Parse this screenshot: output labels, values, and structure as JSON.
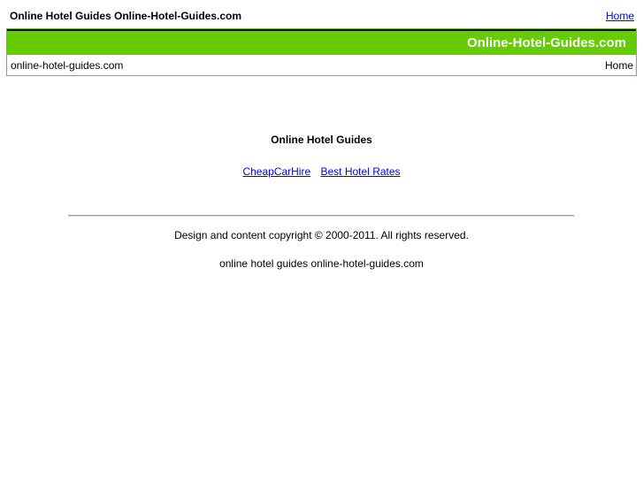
{
  "topbar": {
    "site_title": "Online Hotel Guides Online-Hotel-Guides.com",
    "home_link": "Home"
  },
  "header": {
    "brand": "Online-Hotel-Guides.com",
    "domain": "online-hotel-guides.com",
    "home_label": "Home",
    "accent_color": "#66cc00"
  },
  "main": {
    "heading": "Online Hotel Guides",
    "links": [
      "CheapCarHire",
      "Best Hotel Rates"
    ]
  },
  "footer": {
    "copyright": "Design and content copyright © 2000-2011. All rights reserved.",
    "tagline": "online hotel guides online-hotel-guides.com"
  }
}
